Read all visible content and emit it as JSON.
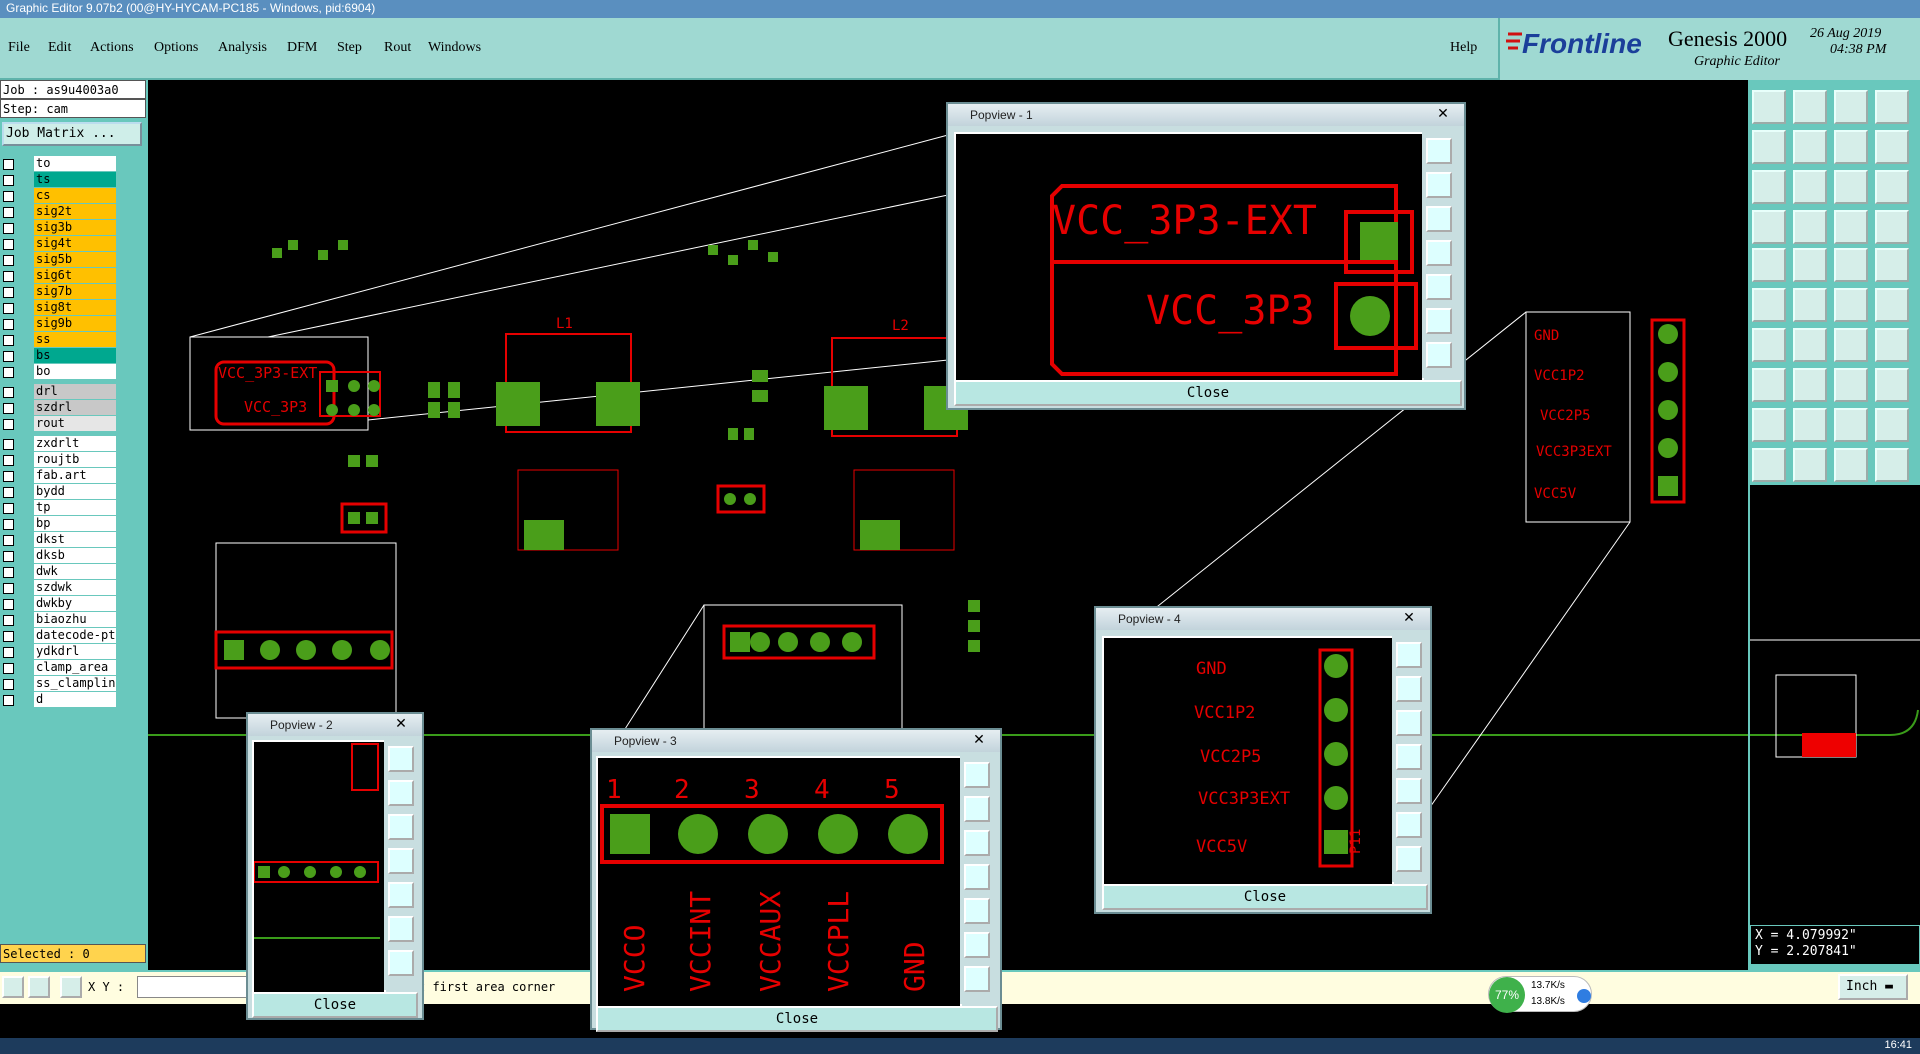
{
  "window_title": "Graphic Editor 9.07b2 (00@HY-HYCAM-PC185 - Windows, pid:6904)",
  "menu": [
    "File",
    "Edit",
    "Actions",
    "Options",
    "Analysis",
    "DFM",
    "Step",
    "Rout",
    "Windows"
  ],
  "help_label": "Help",
  "brand": {
    "logo": "Frontline",
    "product": "Genesis 2000",
    "subtitle": "Graphic Editor",
    "date": "26 Aug 2019",
    "time": "04:38 PM"
  },
  "job": {
    "job": "Job : as9u4003a0",
    "step": "Step: cam",
    "matrix_button": "Job Matrix ..."
  },
  "layers": [
    {
      "name": "to",
      "color": "#ffffff"
    },
    {
      "name": "ts",
      "color": "#00a88f"
    },
    {
      "name": "cs",
      "color": "#ffc000"
    },
    {
      "name": "sig2t",
      "color": "#ffc000"
    },
    {
      "name": "sig3b",
      "color": "#ffc000"
    },
    {
      "name": "sig4t",
      "color": "#ffc000"
    },
    {
      "name": "sig5b",
      "color": "#ffc000"
    },
    {
      "name": "sig6t",
      "color": "#ffc000"
    },
    {
      "name": "sig7b",
      "color": "#ffc000"
    },
    {
      "name": "sig8t",
      "color": "#ffc000"
    },
    {
      "name": "sig9b",
      "color": "#ffc000"
    },
    {
      "name": "ss",
      "color": "#ffc000"
    },
    {
      "name": "bs",
      "color": "#00a88f"
    },
    {
      "name": "bo",
      "color": "#ffffff"
    },
    {
      "name": "drl",
      "color": "#c8c8c8"
    },
    {
      "name": "szdrl",
      "color": "#c8c8c8"
    },
    {
      "name": "rout",
      "color": "#e6e6e6"
    },
    {
      "name": "zxdrlt",
      "color": "#ffffff"
    },
    {
      "name": "roujtb",
      "color": "#ffffff"
    },
    {
      "name": "fab.art",
      "color": "#ffffff"
    },
    {
      "name": "bydd",
      "color": "#ffffff"
    },
    {
      "name": "tp",
      "color": "#ffffff"
    },
    {
      "name": "bp",
      "color": "#ffffff"
    },
    {
      "name": "dkst",
      "color": "#ffffff"
    },
    {
      "name": "dksb",
      "color": "#ffffff"
    },
    {
      "name": "dwk",
      "color": "#ffffff"
    },
    {
      "name": "szdwk",
      "color": "#ffffff"
    },
    {
      "name": "dwkby",
      "color": "#ffffff"
    },
    {
      "name": "biaozhu",
      "color": "#ffffff"
    },
    {
      "name": "datecode-pt",
      "color": "#ffffff"
    },
    {
      "name": "ydkdrl",
      "color": "#ffffff"
    },
    {
      "name": "clamp_area",
      "color": "#ffffff"
    },
    {
      "name": "ss_clamplin",
      "color": "#ffffff"
    },
    {
      "name": "d",
      "color": "#ffffff"
    }
  ],
  "selected": "Selected : 0",
  "xy_label": "X Y :",
  "status_msg": "t first area corner",
  "units": "Inch",
  "coords": {
    "x": "X = 4.079992\"",
    "y": "Y = 2.207841\""
  },
  "network": {
    "percent": "77%",
    "up": "13.7K/s",
    "down": "13.8K/s"
  },
  "clock": "16:41",
  "popviews": [
    {
      "title": "Popview - 1",
      "close": "Close",
      "labels": [
        "VCC_3P3-EXT",
        "VCC_3P3"
      ]
    },
    {
      "title": "Popview - 2",
      "close": "Close"
    },
    {
      "title": "Popview - 3",
      "close": "Close",
      "numbers": [
        "1",
        "2",
        "3",
        "4",
        "5"
      ],
      "labels": [
        "VCCO",
        "VCCINT",
        "VCCAUX",
        "VCCPLL",
        "GND"
      ]
    },
    {
      "title": "Popview - 4",
      "close": "Close",
      "labels": [
        "GND",
        "VCC1P2",
        "VCC2P5",
        "VCC3P3EXT",
        "VCC5V"
      ],
      "ref": "P11"
    }
  ],
  "colors": {
    "copper": "#e60000",
    "pad": "#4a9e1a",
    "bg": "#000000",
    "panel": "#69c8bd"
  }
}
